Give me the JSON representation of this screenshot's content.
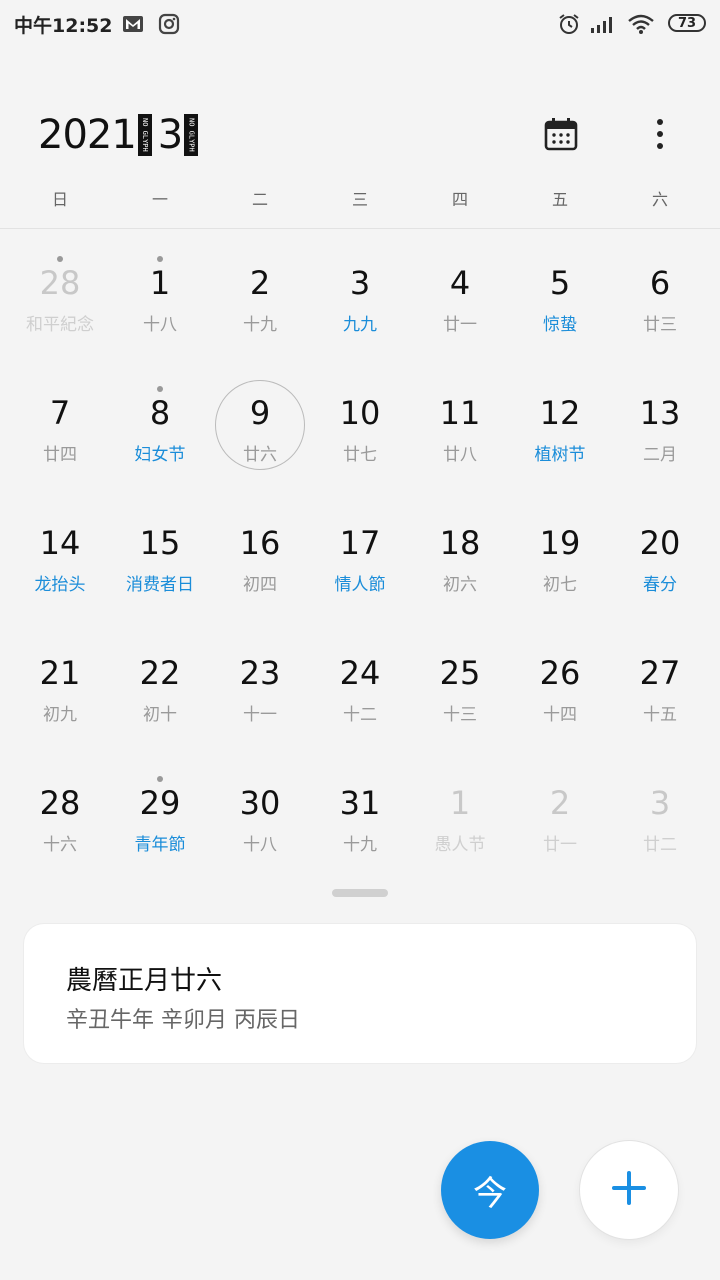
{
  "status_bar": {
    "time": "中午12:52",
    "icons": [
      "gmail-icon",
      "instagram-icon",
      "alarm-icon",
      "signal-icon",
      "wifi-icon"
    ],
    "battery": "73"
  },
  "header": {
    "year": "2021",
    "month": "3",
    "calendar_button_icon": "calendar-icon",
    "more_button_icon": "more-vert-icon"
  },
  "weekdays": [
    "日",
    "一",
    "二",
    "三",
    "四",
    "五",
    "六"
  ],
  "weeks": [
    [
      {
        "num": "28",
        "sub": "和平紀念",
        "other": true,
        "dot": true
      },
      {
        "num": "1",
        "sub": "十八",
        "dot": true
      },
      {
        "num": "2",
        "sub": "十九"
      },
      {
        "num": "3",
        "sub": "九九",
        "hl": true
      },
      {
        "num": "4",
        "sub": "廿一"
      },
      {
        "num": "5",
        "sub": "惊蛰",
        "hl": true
      },
      {
        "num": "6",
        "sub": "廿三"
      }
    ],
    [
      {
        "num": "7",
        "sub": "廿四"
      },
      {
        "num": "8",
        "sub": "妇女节",
        "hl": true,
        "dot": true
      },
      {
        "num": "9",
        "sub": "廿六",
        "today": true
      },
      {
        "num": "10",
        "sub": "廿七"
      },
      {
        "num": "11",
        "sub": "廿八"
      },
      {
        "num": "12",
        "sub": "植树节",
        "hl": true
      },
      {
        "num": "13",
        "sub": "二月"
      }
    ],
    [
      {
        "num": "14",
        "sub": "龙抬头",
        "hl": true
      },
      {
        "num": "15",
        "sub": "消费者日",
        "hl": true
      },
      {
        "num": "16",
        "sub": "初四"
      },
      {
        "num": "17",
        "sub": "情人節",
        "hl": true
      },
      {
        "num": "18",
        "sub": "初六"
      },
      {
        "num": "19",
        "sub": "初七"
      },
      {
        "num": "20",
        "sub": "春分",
        "hl": true
      }
    ],
    [
      {
        "num": "21",
        "sub": "初九"
      },
      {
        "num": "22",
        "sub": "初十"
      },
      {
        "num": "23",
        "sub": "十一"
      },
      {
        "num": "24",
        "sub": "十二"
      },
      {
        "num": "25",
        "sub": "十三"
      },
      {
        "num": "26",
        "sub": "十四"
      },
      {
        "num": "27",
        "sub": "十五"
      }
    ],
    [
      {
        "num": "28",
        "sub": "十六"
      },
      {
        "num": "29",
        "sub": "青年節",
        "hl": true,
        "dot": true
      },
      {
        "num": "30",
        "sub": "十八"
      },
      {
        "num": "31",
        "sub": "十九"
      },
      {
        "num": "1",
        "sub": "愚人节",
        "other": true
      },
      {
        "num": "2",
        "sub": "廿一",
        "other": true
      },
      {
        "num": "3",
        "sub": "廿二",
        "other": true
      }
    ]
  ],
  "info_card": {
    "lunar_date": "農曆正月廿六",
    "ganzhi": "辛丑牛年 辛卯月 丙辰日"
  },
  "fab": {
    "today_label": "今",
    "add_icon": "plus-icon"
  },
  "colors": {
    "accent": "#1a8fe3",
    "highlight_text": "#1b8dd9",
    "background": "#f4f4f4"
  }
}
